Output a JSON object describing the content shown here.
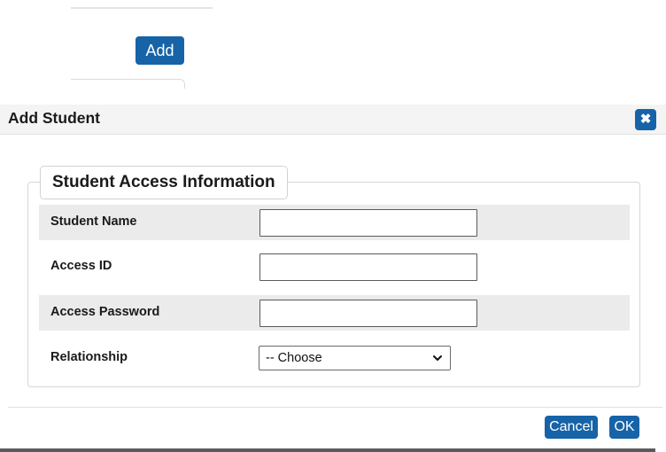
{
  "background": {
    "add_button_label": "Add"
  },
  "dialog": {
    "title": "Add Student",
    "close_symbol": "✖",
    "fieldset": {
      "legend": "Student Access Information",
      "fields": [
        {
          "label": "Student Name",
          "value": ""
        },
        {
          "label": "Access ID",
          "value": ""
        },
        {
          "label": "Access Password",
          "value": ""
        }
      ],
      "relationship": {
        "label": "Relationship",
        "selected": "-- Choose"
      }
    },
    "footer": {
      "cancel_label": "Cancel",
      "ok_label": "OK"
    }
  },
  "colors": {
    "accent": "#1763a8",
    "row_shade": "#ebebeb",
    "header_bg": "#f4f4f4"
  },
  "icons": {
    "close": "close-icon",
    "select": "chevron-down-icon"
  }
}
